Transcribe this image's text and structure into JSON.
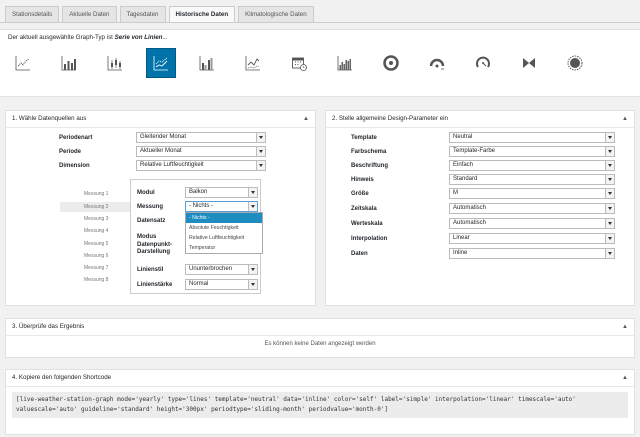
{
  "tabs": [
    {
      "label": "Stationsdetails",
      "active": false
    },
    {
      "label": "Aktuelle Daten",
      "active": false
    },
    {
      "label": "Tagesdaten",
      "active": false
    },
    {
      "label": "Historische Daten",
      "active": true
    },
    {
      "label": "Klimatologische Daten",
      "active": false
    }
  ],
  "graph_type": {
    "prefix": "Der aktuell ausgewählte Graph-Typ ist",
    "selected": "Serie von Linien",
    "suffix": "...",
    "icons": [
      {
        "name": "lines-chart-icon"
      },
      {
        "name": "bars-chart-icon"
      },
      {
        "name": "candlestick-chart-icon"
      },
      {
        "name": "series-lines-chart-icon",
        "active": true
      },
      {
        "name": "grouped-bars-chart-icon"
      },
      {
        "name": "area-line-chart-icon"
      },
      {
        "name": "calendar-chart-icon"
      },
      {
        "name": "histogram-chart-icon"
      },
      {
        "name": "radial-gauge-icon"
      },
      {
        "name": "half-gauge-icon"
      },
      {
        "name": "arc-gauge-icon"
      },
      {
        "name": "windrose-icon"
      },
      {
        "name": "sun-gauge-icon"
      }
    ]
  },
  "panel1": {
    "title": "1. Wähle Datenquellen aus",
    "fields": [
      {
        "label": "Periodenart",
        "value": "Gleitender Monat"
      },
      {
        "label": "Periode",
        "value": "Aktueller Monat"
      },
      {
        "label": "Dimension",
        "value": "Relative Luftfeuchtigkeit"
      }
    ],
    "messungen": [
      "Messung 1",
      "Messung 2",
      "Messung 3",
      "Messung 4",
      "Messung 5",
      "Messung 6",
      "Messung 7",
      "Messung 8"
    ],
    "inner": {
      "modul_label": "Modul",
      "modul_value": "Balkon",
      "messung_label": "Messung",
      "messung_value": "- Nichts -",
      "datensatz_label": "Datensatz",
      "modus_label": "Modus",
      "datenpunkt_label": "Datenpunkt-",
      "darstellung_label": "Darstellung",
      "linienstil_label": "Linienstil",
      "linienstil_value": "Ununterbrochen",
      "linienstaerke_label": "Linienstärke",
      "linienstaerke_value": "Normal",
      "dropdown_options": [
        "- Nichts -",
        "Absolute Feuchtigkeit",
        "Relative Luftfeuchtigkeit",
        "Temperatur"
      ]
    }
  },
  "panel2": {
    "title": "2. Stelle allgemeine Design-Parameter ein",
    "fields": [
      {
        "label": "Template",
        "value": "Neutral"
      },
      {
        "label": "Farbschema",
        "value": "Template-Farbe"
      },
      {
        "label": "Beschriftung",
        "value": "Einfach"
      },
      {
        "label": "Hinweis",
        "value": "Standard"
      },
      {
        "label": "Größe",
        "value": "M"
      },
      {
        "label": "Zeitskala",
        "value": "Automatisch"
      },
      {
        "label": "Werteskala",
        "value": "Automatisch"
      },
      {
        "label": "Interpolation",
        "value": "Linear"
      },
      {
        "label": "Daten",
        "value": "Inline"
      }
    ]
  },
  "panel3": {
    "title": "3. Überprüfe das Ergebnis",
    "message": "Es können keine Daten angezeigt werden"
  },
  "panel4": {
    "title": "4. Kopiere den folgenden Shortcode",
    "shortcode": "[live-weather-station-graph mode='yearly' type='lines' template='neutral' data='inline' color='self' label='simple' interpolation='linear' timescale='auto' valuescale='auto' guideline='standard' height='300px' periodtype='sliding-month' periodvalue='month-0']"
  },
  "colors": {
    "accent": "#0073aa",
    "dropdown_highlight": "#1e8cbe"
  }
}
